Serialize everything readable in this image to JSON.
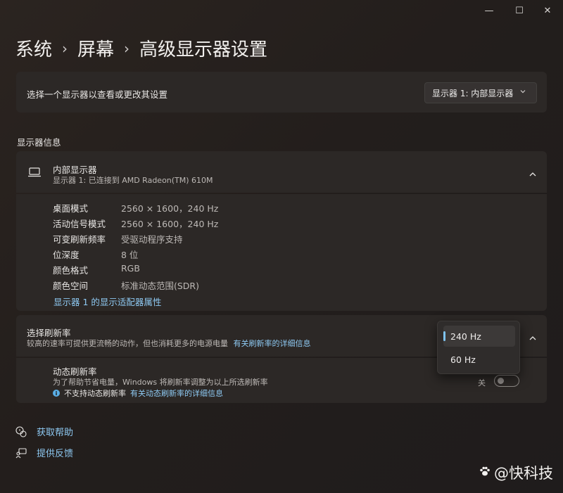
{
  "window": {
    "minimize": "—",
    "maximize": "☐",
    "close": "✕"
  },
  "breadcrumb": {
    "items": [
      "系统",
      "屏幕",
      "高级显示器设置"
    ],
    "separator": "›"
  },
  "display_select": {
    "label": "选择一个显示器以查看或更改其设置",
    "value": "显示器 1: 内部显示器"
  },
  "display_info": {
    "section_title": "显示器信息",
    "title": "内部显示器",
    "subtitle": "显示器 1: 已连接到 AMD Radeon(TM) 610M",
    "rows": [
      {
        "key": "桌面模式",
        "value": "2560 × 1600，240 Hz"
      },
      {
        "key": "活动信号模式",
        "value": "2560 × 1600，240 Hz"
      },
      {
        "key": "可变刷新频率",
        "value": "受驱动程序支持"
      },
      {
        "key": "位深度",
        "value": "8 位"
      },
      {
        "key": "颜色格式",
        "value": "RGB"
      },
      {
        "key": "颜色空间",
        "value": "标准动态范围(SDR)"
      }
    ],
    "adapter_link": "显示器 1 的显示适配器属性"
  },
  "refresh": {
    "title": "选择刷新率",
    "description": "较高的速率可提供更流畅的动作，但也消耗更多的电源电量",
    "more_link": "有关刷新率的详细信息",
    "options": [
      "240 Hz",
      "60 Hz"
    ],
    "selected": "240 Hz"
  },
  "dynamic_refresh": {
    "title": "动态刷新率",
    "description": "为了帮助节省电量，Windows 将刷新率调整为以上所选刷新率",
    "info_icon": "i",
    "not_supported": "不支持动态刷新率",
    "more_link": "有关动态刷新率的详细信息",
    "toggle_label": "关",
    "toggle_state": "off"
  },
  "footer": {
    "help": "获取帮助",
    "feedback": "提供反馈"
  },
  "watermark": {
    "text": "@快科技"
  },
  "colors": {
    "accent": "#8ec9f2",
    "indicator": "#7fc4f2",
    "card": "#2c2826"
  }
}
